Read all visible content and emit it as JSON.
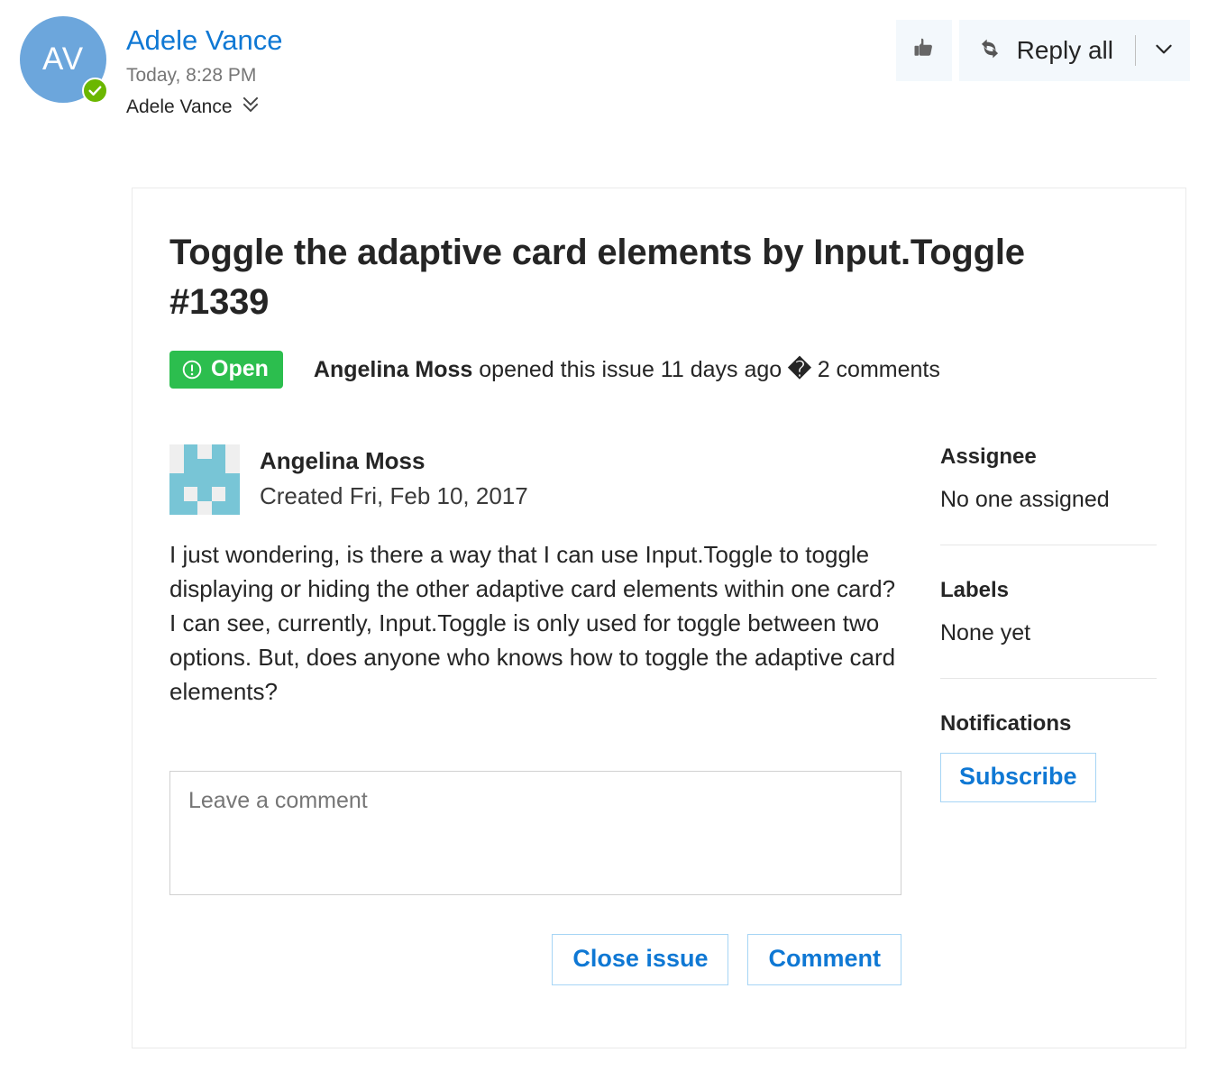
{
  "email": {
    "avatar_initials": "AV",
    "presence_icon": "check-circle-icon",
    "sender_name": "Adele Vance",
    "sent_time": "Today, 8:28 PM",
    "recipient_name": "Adele Vance",
    "expand_icon": "double-chevron-down-icon",
    "toolbar": {
      "like_icon": "thumbs-up-icon",
      "reply_icon": "reply-all-icon",
      "reply_all_label": "Reply all",
      "more_icon": "chevron-down-icon"
    }
  },
  "issue": {
    "title": "Toggle the adaptive card elements by Input.Toggle #1339",
    "state_badge": {
      "icon": "exclamation-circle-icon",
      "label": "Open",
      "color": "#2CBE4E"
    },
    "meta_author": "Angelina Moss",
    "meta_rest": " opened this issue 11 days ago ",
    "meta_separator": "�",
    "meta_comments": " 2 comments",
    "comment": {
      "avatar_icon": "identicon-avatar",
      "author": "Angelina Moss",
      "created": "Created Fri, Feb 10, 2017",
      "body": "I just wondering, is there a way that I can use Input.Toggle to toggle displaying or hiding the other adaptive card elements within one card? I can see, currently, Input.Toggle is only used for toggle between two options. But, does anyone who knows how to toggle the adaptive card elements?"
    },
    "comment_input_placeholder": "Leave a comment",
    "comment_input_value": "",
    "actions": {
      "close_issue_label": "Close issue",
      "comment_label": "Comment"
    },
    "sidebar": {
      "assignee_heading": "Assignee",
      "assignee_value": "No one assigned",
      "labels_heading": "Labels",
      "labels_value": "None yet",
      "notifications_heading": "Notifications",
      "subscribe_label": "Subscribe"
    }
  },
  "identicon_grid": [
    [
      0,
      1,
      0,
      1,
      0
    ],
    [
      0,
      1,
      1,
      1,
      0
    ],
    [
      1,
      1,
      1,
      1,
      1
    ],
    [
      1,
      0,
      1,
      0,
      1
    ],
    [
      1,
      1,
      0,
      1,
      1
    ]
  ],
  "colors": {
    "link": "#0F78D4",
    "open_green": "#2CBE4E",
    "presence_green": "#6BB700",
    "avatar_blue": "#6CA6DC",
    "identicon_teal": "#78C5D6"
  }
}
